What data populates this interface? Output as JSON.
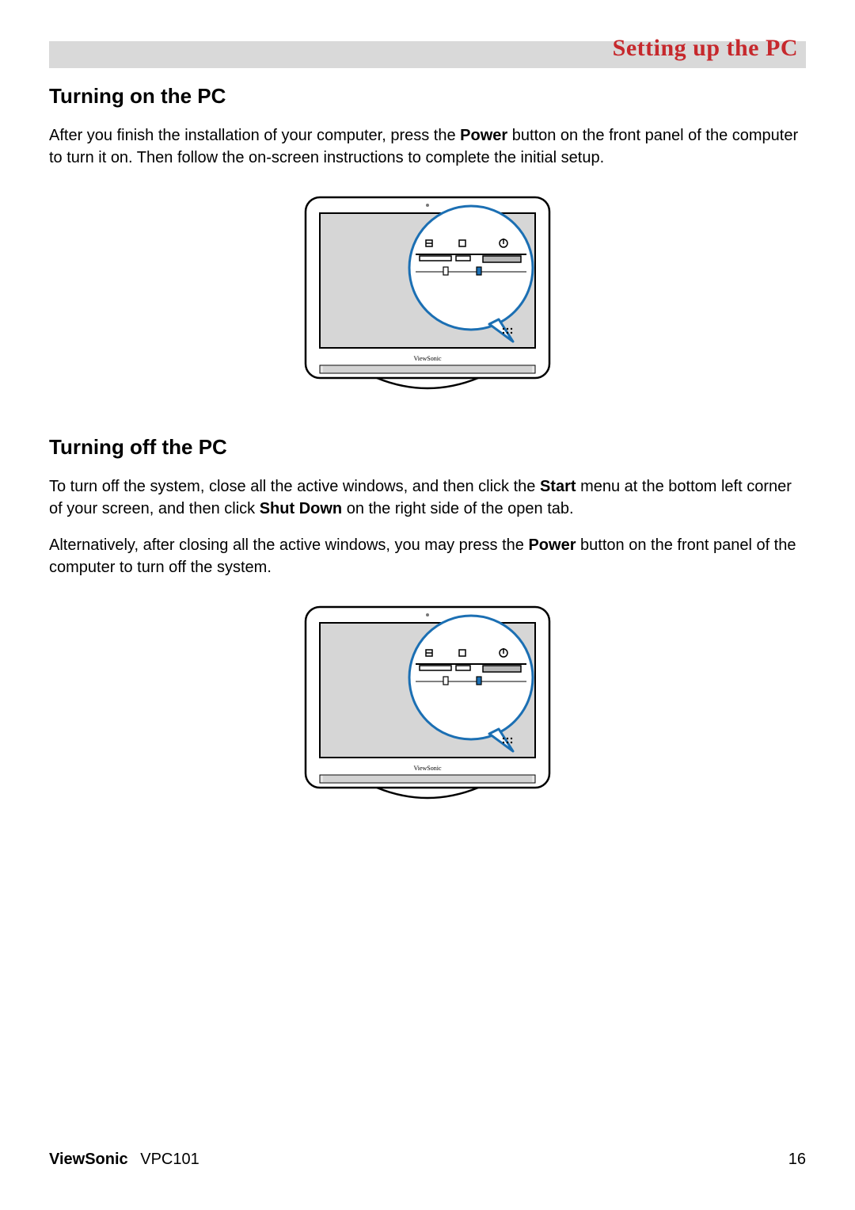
{
  "header": {
    "title": "Setting up the PC"
  },
  "section1": {
    "heading": "Turning on the PC",
    "p1a": "After you finish the installation of your computer, press the ",
    "p1b": "Power",
    "p1c": " button on the front panel of the computer to turn it on. Then follow the on-screen instructions to complete the initial setup."
  },
  "section2": {
    "heading": "Turning off the PC",
    "p1a": "To turn off the system, close all the active windows, and then click the ",
    "p1b": "Start",
    "p1c": " menu at the bottom left corner of your screen, and then click ",
    "p1d": "Shut Down",
    "p1e": " on the right side of the open tab.",
    "p2a": "Alternatively, after closing all the active windows, you may press the ",
    "p2b": "Power",
    "p2c": " button on the front panel of the computer to turn off the system."
  },
  "figure": {
    "brand": "ViewSonic"
  },
  "footer": {
    "brand": "ViewSonic",
    "model": "VPC101",
    "page": "16"
  }
}
